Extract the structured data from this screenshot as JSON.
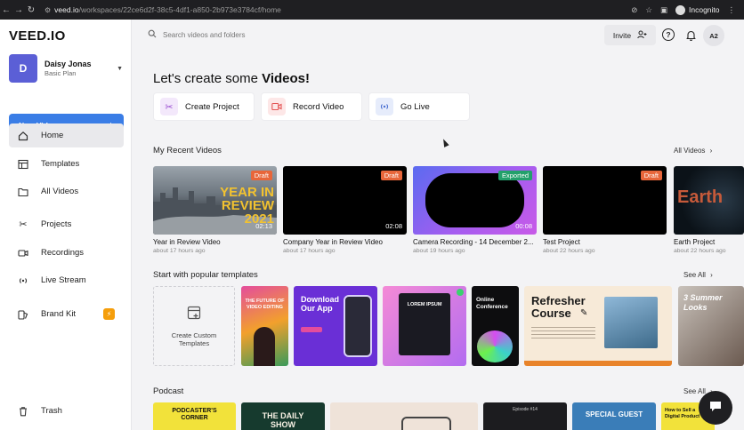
{
  "browser": {
    "url_host": "veed.io",
    "url_path": "/workspaces/22ce6d2f-38c5-4df1-a850-2b973e3784cf/home",
    "incognito_label": "Incognito"
  },
  "sidebar": {
    "logo": "VEED.IO",
    "user": {
      "initial": "D",
      "name": "Daisy Jonas",
      "plan": "Basic Plan"
    },
    "new_video_label": "New Video",
    "items": [
      {
        "label": "Home",
        "icon": "home-icon"
      },
      {
        "label": "Templates",
        "icon": "templates-icon"
      },
      {
        "label": "All Videos",
        "icon": "folder-icon"
      },
      {
        "label": "Projects",
        "icon": "scissors-icon"
      },
      {
        "label": "Recordings",
        "icon": "camera-icon"
      },
      {
        "label": "Live Stream",
        "icon": "broadcast-icon"
      },
      {
        "label": "Brand Kit",
        "icon": "brand-icon"
      },
      {
        "label": "Trash",
        "icon": "trash-icon"
      }
    ]
  },
  "topbar": {
    "search_placeholder": "Search videos and folders",
    "invite_label": "Invite",
    "account_initials": "A2"
  },
  "main": {
    "hero_prefix": "Let's create some",
    "hero_bold": "Videos!",
    "quick_actions": [
      {
        "label": "Create Project",
        "icon": "scissors-icon",
        "color": "#f3e8fb"
      },
      {
        "label": "Record Video",
        "icon": "record-icon",
        "color": "#fde7e7"
      },
      {
        "label": "Go Live",
        "icon": "broadcast-icon",
        "color": "#e6ecfb"
      }
    ],
    "recent": {
      "title": "My Recent Videos",
      "see_all": "All Videos",
      "videos": [
        {
          "title": "Year in Review Video",
          "sub": "about 17 hours ago",
          "tag": "Draft",
          "duration": "02:13",
          "overlay": "YEAR IN REVIEW 2021"
        },
        {
          "title": "Company Year in Review Video",
          "sub": "about 17 hours ago",
          "tag": "Draft",
          "duration": "02:08"
        },
        {
          "title": "Camera Recording - 14 December 2...",
          "sub": "about 19 hours ago",
          "tag": "Exported",
          "duration": "00:08"
        },
        {
          "title": "Test Project",
          "sub": "about 22 hours ago",
          "tag": "Draft",
          "duration": ""
        },
        {
          "title": "Earth Project",
          "sub": "about 22 hours ago",
          "tag": "",
          "duration": "",
          "overlay": "Earth"
        }
      ]
    },
    "templates": {
      "title": "Start with popular templates",
      "see_all": "See All",
      "custom_label": "Create Custom Templates",
      "cards": [
        {
          "text": "THE FUTURE OF VIDEO EDITING"
        },
        {
          "text": "Download Our App"
        },
        {
          "text": "LOREM IPSUM"
        },
        {
          "text": "Online Conference"
        },
        {
          "text": "Refresher Course"
        },
        {
          "text": "3 Summer Looks"
        }
      ]
    },
    "podcast": {
      "title": "Podcast",
      "see_all": "See All",
      "cards": [
        {
          "text": "PODCASTER'S CORNER"
        },
        {
          "text": "THE DAILY SHOW"
        },
        {
          "text": ""
        },
        {
          "text": "Episode #14"
        },
        {
          "text": "SPECIAL GUEST"
        },
        {
          "text": "How to Sell a Digital Product"
        }
      ]
    }
  }
}
